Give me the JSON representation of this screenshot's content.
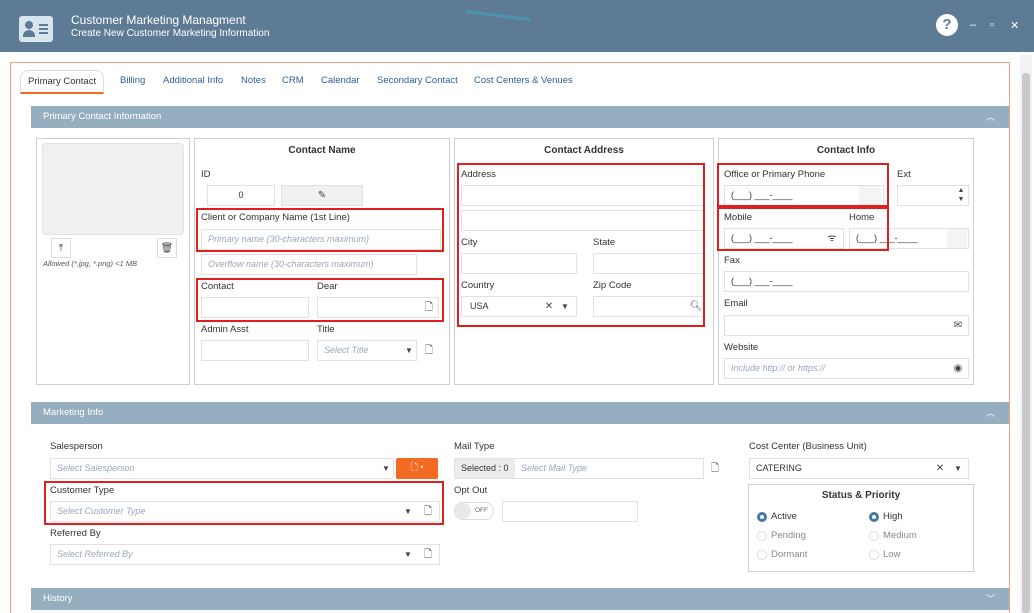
{
  "window": {
    "title": "Customer Marketing Managment",
    "subtitle": "Create New Customer Marketing Information",
    "help": "?",
    "min": "–",
    "max": "▫",
    "close": "✕"
  },
  "tabs": [
    "Primary Contact",
    "Billing",
    "Additional Info",
    "Notes",
    "CRM",
    "Calendar",
    "Secondary Contact",
    "Cost Centers & Venues"
  ],
  "sections": {
    "primary": "Primary Contact Information",
    "marketing": "Marketing Info",
    "history": "History"
  },
  "photo": {
    "note": "Allowed (*.jpg, *.png) <1 MB"
  },
  "contact_name": {
    "title": "Contact Name",
    "id_label": "ID",
    "id_value": "0",
    "company_label": "Client or Company Name (1st Line)",
    "company_ph": "Primary name (30-characters maximum)",
    "overflow_ph": "Overflow name (30-characters maximum)",
    "contact_label": "Contact",
    "dear_label": "Dear",
    "admin_label": "Admin Asst",
    "title_label": "Title",
    "title_ph": "Select Title"
  },
  "address": {
    "title": "Contact Address",
    "address_label": "Address",
    "city_label": "City",
    "state_label": "State",
    "country_label": "Country",
    "country_value": "USA",
    "zip_label": "Zip Code"
  },
  "contact_info": {
    "title": "Contact Info",
    "office_label": "Office or Primary Phone",
    "phone_mask": "(___) ___-____",
    "ext_label": "Ext",
    "mobile_label": "Mobile",
    "home_label": "Home",
    "fax_label": "Fax",
    "email_label": "Email",
    "website_label": "Website",
    "website_ph": "Include http:// or https://"
  },
  "marketing": {
    "salesperson_label": "Salesperson",
    "salesperson_ph": "Select Salesperson",
    "mailtype_label": "Mail Type",
    "selected_text": "Selected : 0",
    "mailtype_ph": "Select Mail Type",
    "costcenter_label": "Cost Center (Business Unit)",
    "costcenter_value": "CATERING",
    "custtype_label": "Customer Type",
    "custtype_ph": "Select Customer Type",
    "optout_label": "Opt Out",
    "optout_value": "OFF",
    "referred_label": "Referred By",
    "referred_ph": "Select Referred By",
    "status_title": "Status & Priority",
    "status": [
      "Active",
      "Pending",
      "Dormant"
    ],
    "priority": [
      "High",
      "Medium",
      "Low"
    ]
  }
}
